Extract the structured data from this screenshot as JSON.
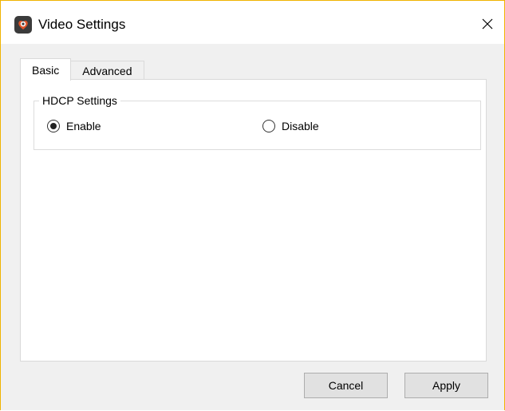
{
  "window": {
    "title": "Video Settings",
    "app_icon": "app-logo-icon",
    "close_icon": "close-icon"
  },
  "tabs": [
    {
      "label": "Basic",
      "active": true
    },
    {
      "label": "Advanced",
      "active": false
    }
  ],
  "hdcp": {
    "group_label": "HDCP Settings",
    "options": [
      {
        "label": "Enable",
        "checked": true
      },
      {
        "label": "Disable",
        "checked": false
      }
    ]
  },
  "footer": {
    "cancel_label": "Cancel",
    "apply_label": "Apply"
  },
  "colors": {
    "window_border": "#f0b400",
    "body_background": "#f0f0f0",
    "app_icon_bg": "#3b3b3b",
    "app_icon_accent": "#e0552a"
  }
}
